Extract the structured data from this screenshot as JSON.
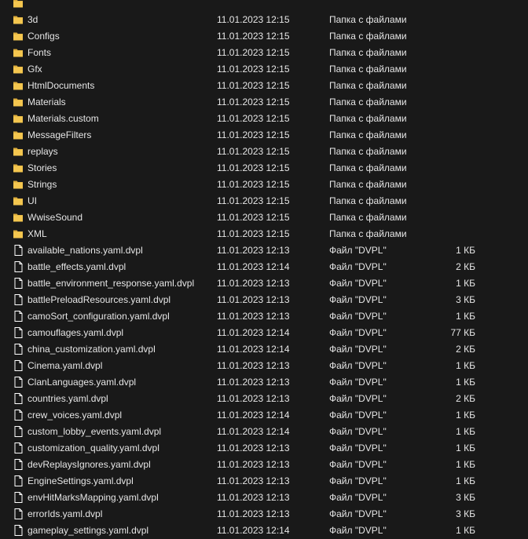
{
  "folders": [
    {
      "name": "",
      "date": "",
      "type": ""
    },
    {
      "name": "3d",
      "date": "11.01.2023 12:15",
      "type": "Папка с файлами"
    },
    {
      "name": "Configs",
      "date": "11.01.2023 12:15",
      "type": "Папка с файлами"
    },
    {
      "name": "Fonts",
      "date": "11.01.2023 12:15",
      "type": "Папка с файлами"
    },
    {
      "name": "Gfx",
      "date": "11.01.2023 12:15",
      "type": "Папка с файлами"
    },
    {
      "name": "HtmlDocuments",
      "date": "11.01.2023 12:15",
      "type": "Папка с файлами"
    },
    {
      "name": "Materials",
      "date": "11.01.2023 12:15",
      "type": "Папка с файлами"
    },
    {
      "name": "Materials.custom",
      "date": "11.01.2023 12:15",
      "type": "Папка с файлами"
    },
    {
      "name": "MessageFilters",
      "date": "11.01.2023 12:15",
      "type": "Папка с файлами"
    },
    {
      "name": "replays",
      "date": "11.01.2023 12:15",
      "type": "Папка с файлами"
    },
    {
      "name": "Stories",
      "date": "11.01.2023 12:15",
      "type": "Папка с файлами"
    },
    {
      "name": "Strings",
      "date": "11.01.2023 12:15",
      "type": "Папка с файлами"
    },
    {
      "name": "UI",
      "date": "11.01.2023 12:15",
      "type": "Папка с файлами"
    },
    {
      "name": "WwiseSound",
      "date": "11.01.2023 12:15",
      "type": "Папка с файлами"
    },
    {
      "name": "XML",
      "date": "11.01.2023 12:15",
      "type": "Папка с файлами"
    }
  ],
  "files": [
    {
      "name": "available_nations.yaml.dvpl",
      "date": "11.01.2023 12:13",
      "type": "Файл \"DVPL\"",
      "size": "1 КБ"
    },
    {
      "name": "battle_effects.yaml.dvpl",
      "date": "11.01.2023 12:14",
      "type": "Файл \"DVPL\"",
      "size": "2 КБ"
    },
    {
      "name": "battle_environment_response.yaml.dvpl",
      "date": "11.01.2023 12:13",
      "type": "Файл \"DVPL\"",
      "size": "1 КБ"
    },
    {
      "name": "battlePreloadResources.yaml.dvpl",
      "date": "11.01.2023 12:13",
      "type": "Файл \"DVPL\"",
      "size": "3 КБ"
    },
    {
      "name": "camoSort_configuration.yaml.dvpl",
      "date": "11.01.2023 12:13",
      "type": "Файл \"DVPL\"",
      "size": "1 КБ"
    },
    {
      "name": "camouflages.yaml.dvpl",
      "date": "11.01.2023 12:14",
      "type": "Файл \"DVPL\"",
      "size": "77 КБ"
    },
    {
      "name": "china_customization.yaml.dvpl",
      "date": "11.01.2023 12:14",
      "type": "Файл \"DVPL\"",
      "size": "2 КБ"
    },
    {
      "name": "Cinema.yaml.dvpl",
      "date": "11.01.2023 12:13",
      "type": "Файл \"DVPL\"",
      "size": "1 КБ"
    },
    {
      "name": "ClanLanguages.yaml.dvpl",
      "date": "11.01.2023 12:13",
      "type": "Файл \"DVPL\"",
      "size": "1 КБ"
    },
    {
      "name": "countries.yaml.dvpl",
      "date": "11.01.2023 12:13",
      "type": "Файл \"DVPL\"",
      "size": "2 КБ"
    },
    {
      "name": "crew_voices.yaml.dvpl",
      "date": "11.01.2023 12:14",
      "type": "Файл \"DVPL\"",
      "size": "1 КБ"
    },
    {
      "name": "custom_lobby_events.yaml.dvpl",
      "date": "11.01.2023 12:14",
      "type": "Файл \"DVPL\"",
      "size": "1 КБ"
    },
    {
      "name": "customization_quality.yaml.dvpl",
      "date": "11.01.2023 12:13",
      "type": "Файл \"DVPL\"",
      "size": "1 КБ"
    },
    {
      "name": "devReplaysIgnores.yaml.dvpl",
      "date": "11.01.2023 12:13",
      "type": "Файл \"DVPL\"",
      "size": "1 КБ"
    },
    {
      "name": "EngineSettings.yaml.dvpl",
      "date": "11.01.2023 12:13",
      "type": "Файл \"DVPL\"",
      "size": "1 КБ"
    },
    {
      "name": "envHitMarksMapping.yaml.dvpl",
      "date": "11.01.2023 12:13",
      "type": "Файл \"DVPL\"",
      "size": "3 КБ"
    },
    {
      "name": "errorIds.yaml.dvpl",
      "date": "11.01.2023 12:13",
      "type": "Файл \"DVPL\"",
      "size": "3 КБ"
    },
    {
      "name": "gameplay_settings.yaml.dvpl",
      "date": "11.01.2023 12:14",
      "type": "Файл \"DVPL\"",
      "size": "1 КБ"
    },
    {
      "name": "",
      "date": "",
      "type": "",
      "size": ""
    }
  ],
  "colors": {
    "background": "#191919",
    "text": "#e6e6e6",
    "folder": "#f4c64f",
    "folder_dark": "#d9a93a",
    "file": "#ffffff"
  },
  "icons": {
    "folder": "folder-icon",
    "file": "file-icon"
  }
}
